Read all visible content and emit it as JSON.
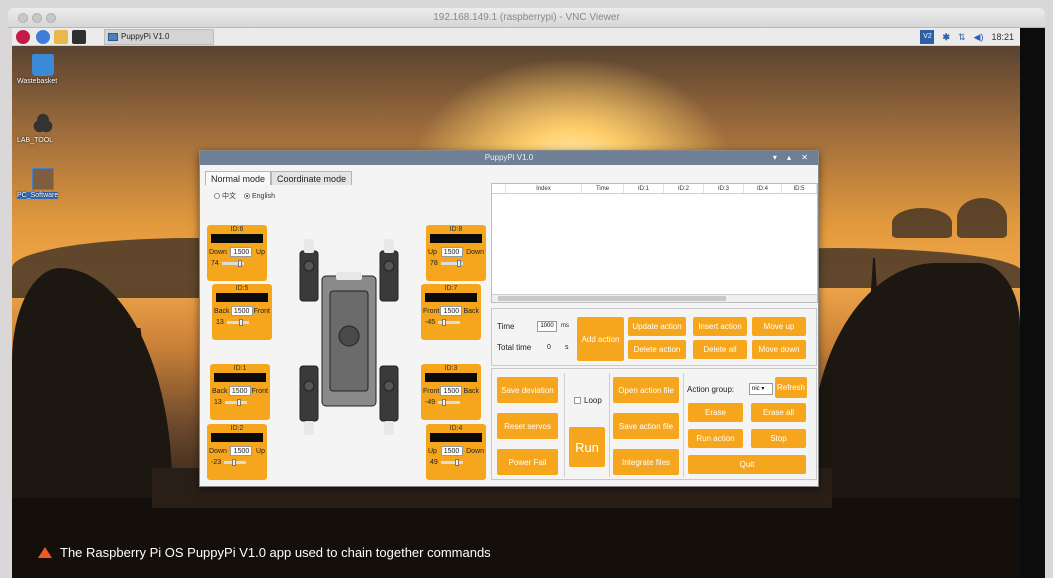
{
  "vnc_window": {
    "title": "192.168.149.1 (raspberrypi) - VNC Viewer"
  },
  "taskbar": {
    "task_label": "PuppyPi V1.0",
    "vnc_badge": "V2",
    "clock": "18:21"
  },
  "desktop_icons": [
    {
      "label": "Wastebasket"
    },
    {
      "label": "LAB_TOOL"
    },
    {
      "label": "PC_Software"
    }
  ],
  "app": {
    "title": "PuppyPi V1.0",
    "window_controls": "▾ ▴ ✕",
    "tabs": [
      {
        "label": "Normal mode"
      },
      {
        "label": "Coordinate mode"
      }
    ],
    "language": {
      "options": [
        "中文",
        "English"
      ],
      "selected": "English"
    },
    "servos": {
      "id6": {
        "id": "ID:6",
        "left": "Down",
        "value": "1500",
        "right": "Up",
        "angle": "74"
      },
      "id5": {
        "id": "ID:5",
        "left": "Back",
        "value": "1500",
        "right": "Front",
        "angle": "13"
      },
      "id1": {
        "id": "ID:1",
        "left": "Back",
        "value": "1500",
        "right": "Front",
        "angle": "13"
      },
      "id2": {
        "id": "ID:2",
        "left": "Down",
        "value": "1500",
        "right": "Up",
        "angle": "-23"
      },
      "id8": {
        "id": "ID:8",
        "left": "Up",
        "value": "1500",
        "right": "Down",
        "angle": "78"
      },
      "id7": {
        "id": "ID:7",
        "left": "Front",
        "value": "1500",
        "right": "Back",
        "angle": "-45"
      },
      "id3": {
        "id": "ID:3",
        "left": "Front",
        "value": "1500",
        "right": "Back",
        "angle": "-49"
      },
      "id4": {
        "id": "ID:4",
        "left": "Up",
        "value": "1500",
        "right": "Down",
        "angle": "49"
      }
    },
    "table": {
      "columns": [
        "Index",
        "Time",
        "ID:1",
        "ID:2",
        "ID:3",
        "ID:4",
        "ID:5"
      ]
    },
    "time": {
      "time_label": "Time",
      "time_value": "1000",
      "time_unit": "ms",
      "total_label": "Total time",
      "total_value": "0",
      "total_unit": "s"
    },
    "buttons": {
      "add_action": "Add action",
      "update_action": "Update action",
      "insert_action": "Insert action",
      "move_up": "Move up",
      "delete_action": "Delete action",
      "delete_all": "Delete all",
      "move_down": "Move down",
      "save_deviation": "Save deviation",
      "reset_servos": "Reset servos",
      "power_fail": "Power Fail",
      "run": "Run",
      "open_action_file": "Open action file",
      "save_action_file": "Save action file",
      "integrate_files": "Integrate files",
      "refresh": "Refresh",
      "erase": "Erase",
      "erase_all": "Erase all",
      "run_action": "Run action",
      "stop": "Stop",
      "quit": "Quit"
    },
    "loop_label": "Loop",
    "action_group_label": "Action group:",
    "action_group_value": "nic"
  },
  "caption": "The Raspberry Pi OS PuppyPi V1.0 app used to chain together commands",
  "colors": {
    "accent": "#f5a61c",
    "caption_marker": "#ee5a24",
    "app_titlebar": "#6e7f96"
  }
}
